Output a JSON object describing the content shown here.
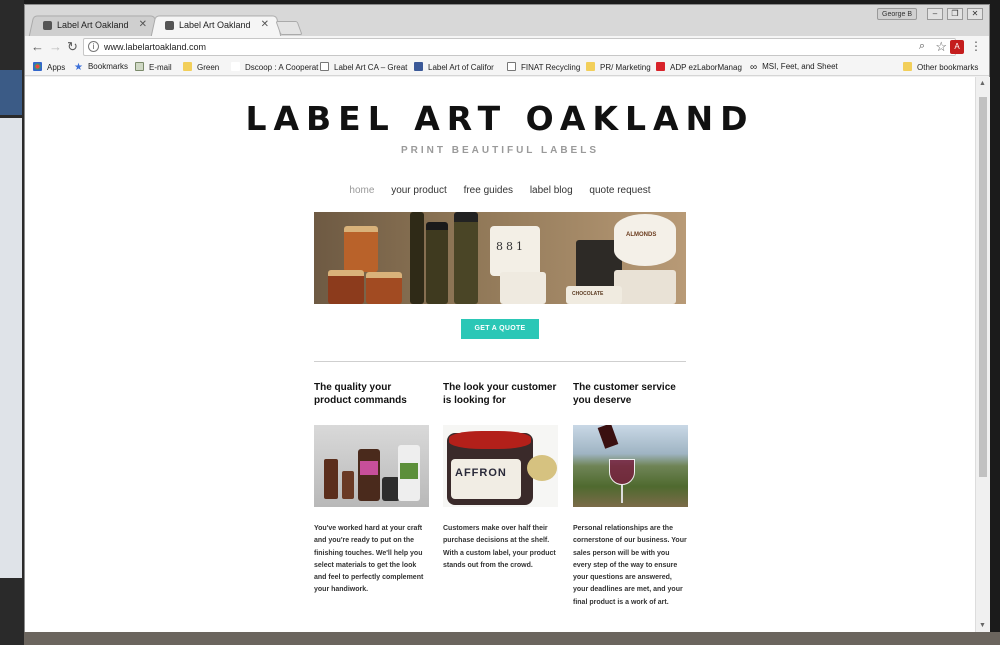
{
  "browser": {
    "tabs": [
      {
        "title": "Label Art Oakland",
        "active": false
      },
      {
        "title": "Label Art Oakland",
        "active": true
      }
    ],
    "profile_label": "George B",
    "url": "www.labelartoakland.com",
    "bookmarks": [
      {
        "label": "Apps",
        "icon": "apps-grid-icon"
      },
      {
        "label": "Bookmarks",
        "icon": "star-icon"
      },
      {
        "label": "E-mail",
        "icon": "envelope-icon"
      },
      {
        "label": "Green",
        "icon": "folder-icon"
      },
      {
        "label": "Dscoop : A Cooperat",
        "icon": "blank-icon"
      },
      {
        "label": "Label Art CA – Great",
        "icon": "page-icon"
      },
      {
        "label": "Label Art of Califor",
        "icon": "facebook-icon"
      },
      {
        "label": "FINAT Recycling",
        "icon": "page-icon"
      },
      {
        "label": "PR/ Marketing",
        "icon": "folder-icon"
      },
      {
        "label": "ADP ezLaborManag",
        "icon": "adp-icon"
      },
      {
        "label": "MSI, Feet, and Sheet",
        "icon": "infinity-icon"
      },
      {
        "label": "Other bookmarks",
        "icon": "folder-icon"
      }
    ]
  },
  "site": {
    "title": "LABEL ART OAKLAND",
    "tagline": "PRINT BEAUTIFUL LABELS",
    "nav": [
      "home",
      "your product",
      "free guides",
      "label blog",
      "quote request"
    ],
    "cta": "GET A QUOTE",
    "columns": [
      {
        "heading": "The quality your product commands",
        "photo": "cosmetic-bottles-photo",
        "body": "You've worked hard at your craft and you're ready to put on the finishing touches. We'll help you select materials to get the look and feel to perfectly complement your handiwork."
      },
      {
        "heading": "The look your customer is looking for",
        "photo": "saffron-jar-photo",
        "body": "Customers make over half their purchase decisions at the shelf. With a custom label, your product stands out from the crowd."
      },
      {
        "heading": "The customer service you deserve",
        "photo": "wine-vineyard-photo",
        "body": "Personal relationships are the cornerstone of our business. Your sales person will be with you every step of the way to ensure your questions are answered, your deadlines are met, and your final product is a work of art."
      }
    ],
    "hero_text": {
      "mug": "881",
      "almonds": "ALMONDS",
      "chocolate": "CHOCOLATE",
      "saffron": "AFFRON"
    }
  },
  "colors": {
    "accent": "#2bc7b6",
    "nav_current": "#999999"
  }
}
